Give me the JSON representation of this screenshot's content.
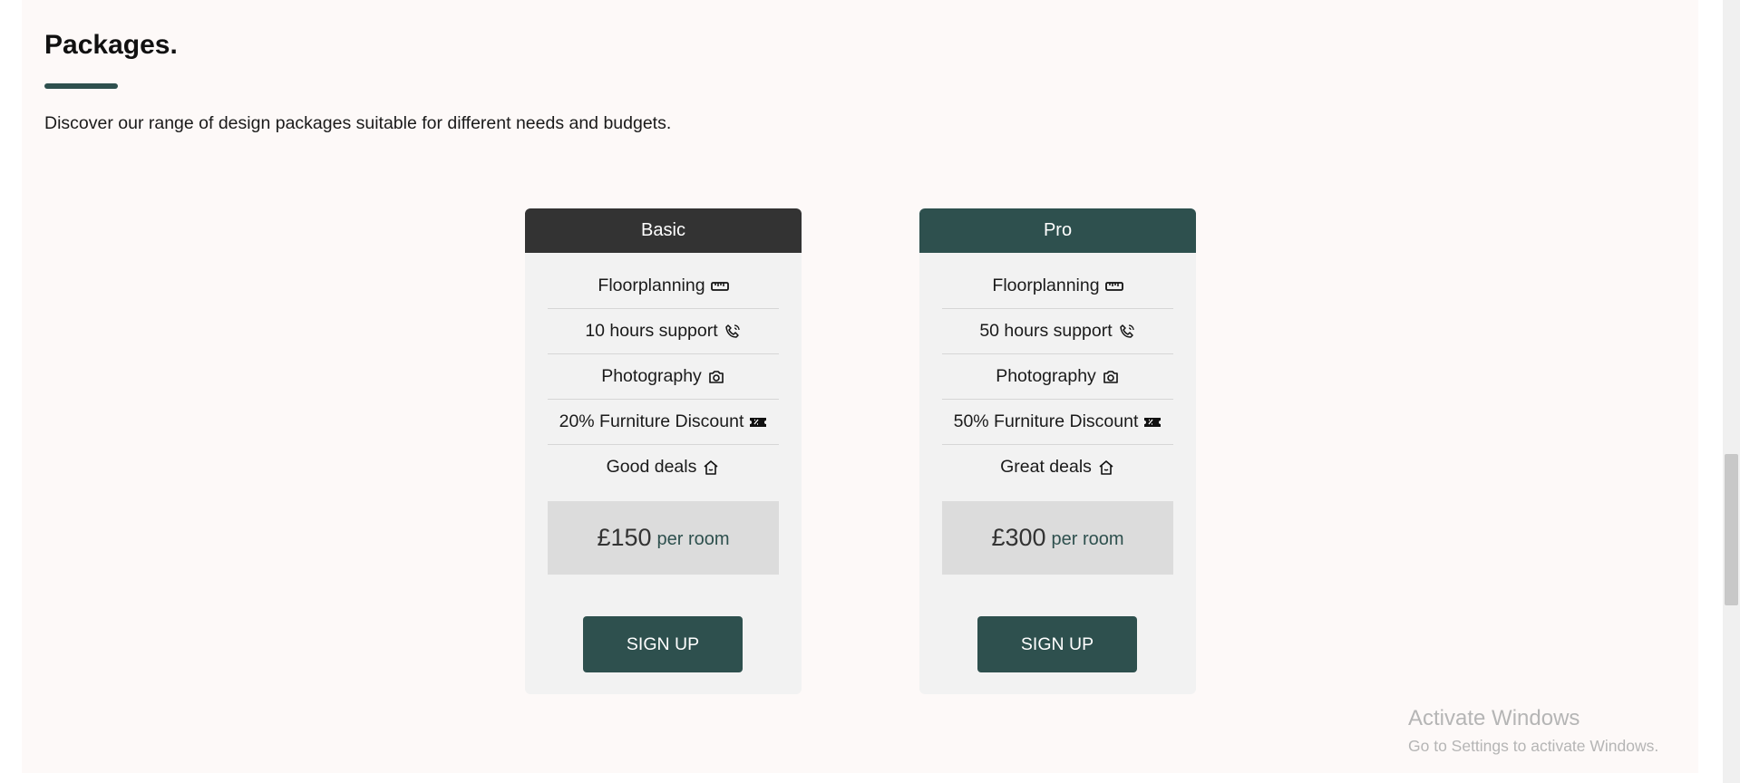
{
  "section": {
    "title": "Packages.",
    "subtitle": "Discover our range of design packages suitable for different needs and budgets."
  },
  "packages": [
    {
      "name": "Basic",
      "header_color": "#333333",
      "features": [
        {
          "label": "Floorplanning",
          "icon": "ruler-icon"
        },
        {
          "label": "10 hours support",
          "icon": "phone-icon"
        },
        {
          "label": "Photography",
          "icon": "camera-icon"
        },
        {
          "label": "20% Furniture Discount",
          "icon": "ticket-icon"
        },
        {
          "label": "Good deals",
          "icon": "house-icon"
        }
      ],
      "price": "£150",
      "price_unit": "per room",
      "cta": "SIGN UP"
    },
    {
      "name": "Pro",
      "header_color": "#2e504e",
      "features": [
        {
          "label": "Floorplanning",
          "icon": "ruler-icon"
        },
        {
          "label": "50 hours support",
          "icon": "phone-icon"
        },
        {
          "label": "Photography",
          "icon": "camera-icon"
        },
        {
          "label": "50% Furniture Discount",
          "icon": "ticket-icon"
        },
        {
          "label": "Great deals",
          "icon": "house-icon"
        }
      ],
      "price": "£300",
      "price_unit": "per room",
      "cta": "SIGN UP"
    }
  ],
  "watermark": {
    "title": "Activate Windows",
    "subtitle": "Go to Settings to activate Windows."
  },
  "colors": {
    "accent": "#2e504e",
    "dark": "#333333",
    "card_bg": "#f2f2f2",
    "price_bg": "#dcdcdc",
    "page_bg": "#fdf9f8"
  }
}
